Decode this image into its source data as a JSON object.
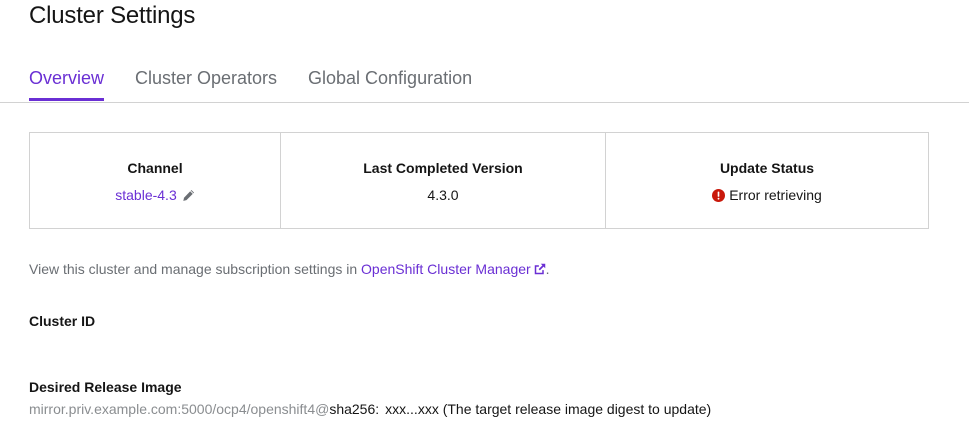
{
  "page": {
    "title": "Cluster Settings"
  },
  "tabs": [
    {
      "label": "Overview",
      "active": true
    },
    {
      "label": "Cluster Operators",
      "active": false
    },
    {
      "label": "Global Configuration",
      "active": false
    }
  ],
  "summary": {
    "channel": {
      "heading": "Channel",
      "value": "stable-4.3",
      "icon": "pencil-icon"
    },
    "last_version": {
      "heading": "Last Completed Version",
      "value": "4.3.0"
    },
    "update_status": {
      "heading": "Update Status",
      "value": "Error retrieving",
      "icon": "error-circle-icon"
    }
  },
  "description": {
    "prefix": "View this cluster and manage subscription settings in ",
    "link_text": "OpenShift Cluster Manager",
    "suffix": ".",
    "link_icon": "external-link-icon"
  },
  "details": {
    "cluster_id_label": "Cluster ID",
    "release_image_label": "Desired Release Image",
    "release_image_prefix": "mirror.priv.example.com:5000/ocp4/openshift4@",
    "release_image_sha": "sha256:",
    "release_image_note": "xxx...xxx (The target release image digest to update)"
  },
  "colors": {
    "accent": "#6a2fd4",
    "error": "#c9190b",
    "border": "#d2d2d2",
    "muted_text": "#6a6e73"
  }
}
